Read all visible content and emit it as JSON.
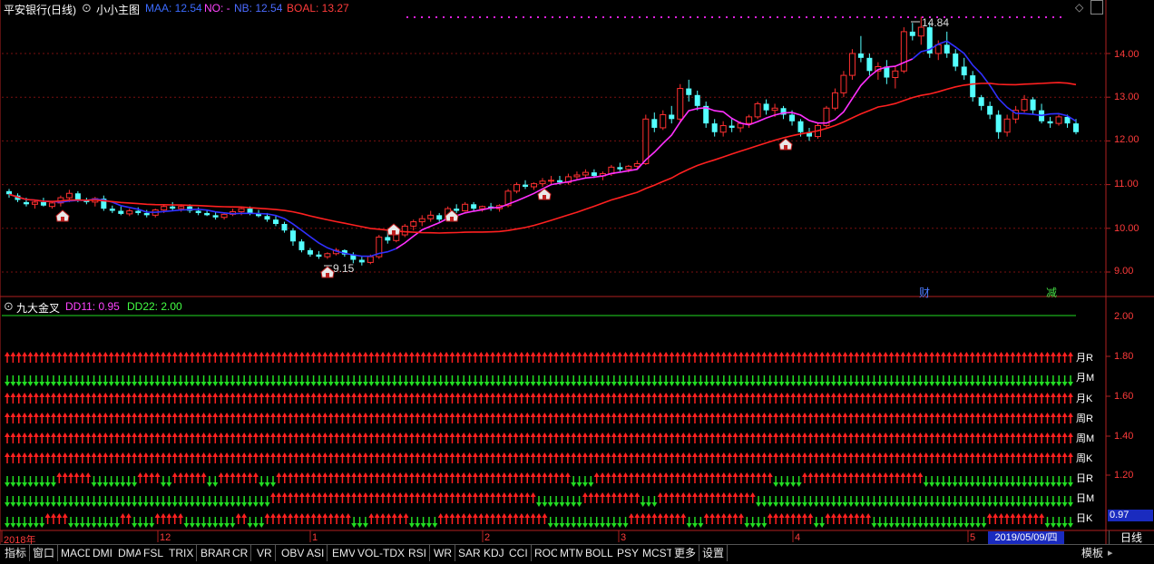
{
  "main": {
    "title": "平安银行(日线)",
    "indicator_name": "小小主图",
    "maa": "MAA: 12.54",
    "no": "NO: -",
    "nb": "NB: 12.54",
    "boal": "BOAL: 13.27",
    "high_label": "14.84",
    "low_label": "9.15",
    "event_cai": "财",
    "event_jian": "减",
    "price_ticks": [
      "14.00",
      "13.00",
      "12.00",
      "11.00",
      "10.00",
      "9.00"
    ]
  },
  "sub": {
    "indicator_name": "九大金叉",
    "dd11": "DD11: 0.95",
    "dd22": "DD22: 2.00",
    "value_ticks": [
      "2.00",
      "1.80",
      "1.60",
      "1.40",
      "1.20"
    ],
    "current_value": "0.97",
    "row_labels": [
      "月R",
      "月M",
      "月K",
      "周R",
      "周M",
      "周K",
      "日R",
      "日M",
      "日K"
    ]
  },
  "time_axis": {
    "labels": [
      "2018年",
      "12",
      "1",
      "2",
      "3",
      "4",
      "5"
    ],
    "cursor_date": "2019/05/09/四",
    "period": "日线"
  },
  "tabs": [
    "指标",
    "窗口",
    "MACD",
    "DMI",
    "DMA",
    "FSL",
    "TRIX",
    "BRAR",
    "CR",
    "VR",
    "OBV",
    "ASI",
    "EMV",
    "VOL-TDX",
    "RSI",
    "WR",
    "SAR",
    "KDJ",
    "CCI",
    "ROC",
    "MTM",
    "BOLL",
    "PSY",
    "MCST",
    "更多",
    "设置"
  ],
  "template_tab": "模板",
  "chart_data": {
    "type": "candlestick",
    "ylim": [
      8.8,
      14.9
    ],
    "ohlc": [
      [
        10.85,
        10.9,
        10.7,
        10.78
      ],
      [
        10.75,
        10.8,
        10.6,
        10.65
      ],
      [
        10.6,
        10.7,
        10.5,
        10.55
      ],
      [
        10.55,
        10.65,
        10.45,
        10.6
      ],
      [
        10.6,
        10.7,
        10.5,
        10.52
      ],
      [
        10.5,
        10.62,
        10.45,
        10.58
      ],
      [
        10.58,
        10.75,
        10.5,
        10.7
      ],
      [
        10.7,
        10.88,
        10.6,
        10.8
      ],
      [
        10.8,
        10.85,
        10.6,
        10.65
      ],
      [
        10.65,
        10.7,
        10.55,
        10.6
      ],
      [
        10.6,
        10.72,
        10.5,
        10.68
      ],
      [
        10.68,
        10.75,
        10.4,
        10.45
      ],
      [
        10.45,
        10.52,
        10.35,
        10.4
      ],
      [
        10.4,
        10.5,
        10.3,
        10.33
      ],
      [
        10.33,
        10.45,
        10.28,
        10.4
      ],
      [
        10.4,
        10.48,
        10.3,
        10.35
      ],
      [
        10.35,
        10.42,
        10.25,
        10.3
      ],
      [
        10.3,
        10.45,
        10.25,
        10.42
      ],
      [
        10.42,
        10.55,
        10.35,
        10.5
      ],
      [
        10.5,
        10.6,
        10.4,
        10.45
      ],
      [
        10.45,
        10.55,
        10.38,
        10.5
      ],
      [
        10.5,
        10.55,
        10.35,
        10.4
      ],
      [
        10.4,
        10.48,
        10.3,
        10.35
      ],
      [
        10.35,
        10.42,
        10.28,
        10.3
      ],
      [
        10.3,
        10.38,
        10.2,
        10.25
      ],
      [
        10.25,
        10.35,
        10.2,
        10.32
      ],
      [
        10.32,
        10.45,
        10.28,
        10.38
      ],
      [
        10.38,
        10.5,
        10.3,
        10.45
      ],
      [
        10.45,
        10.5,
        10.3,
        10.35
      ],
      [
        10.35,
        10.42,
        10.25,
        10.28
      ],
      [
        10.28,
        10.35,
        10.15,
        10.2
      ],
      [
        10.2,
        10.28,
        10.05,
        10.1
      ],
      [
        10.1,
        10.15,
        9.9,
        9.95
      ],
      [
        9.95,
        10.0,
        9.6,
        9.7
      ],
      [
        9.7,
        9.75,
        9.45,
        9.5
      ],
      [
        9.5,
        9.55,
        9.35,
        9.4
      ],
      [
        9.4,
        9.48,
        9.3,
        9.35
      ],
      [
        9.35,
        9.45,
        9.3,
        9.42
      ],
      [
        9.42,
        9.55,
        9.38,
        9.5
      ],
      [
        9.5,
        9.52,
        9.35,
        9.4
      ],
      [
        9.4,
        9.45,
        9.2,
        9.28
      ],
      [
        9.28,
        9.35,
        9.15,
        9.22
      ],
      [
        9.22,
        9.4,
        9.18,
        9.35
      ],
      [
        9.35,
        9.85,
        9.3,
        9.8
      ],
      [
        9.8,
        9.95,
        9.65,
        9.72
      ],
      [
        9.72,
        9.9,
        9.68,
        9.85
      ],
      [
        9.85,
        10.1,
        9.8,
        10.05
      ],
      [
        10.05,
        10.2,
        9.95,
        10.15
      ],
      [
        10.15,
        10.3,
        10.05,
        10.22
      ],
      [
        10.22,
        10.4,
        10.15,
        10.3
      ],
      [
        10.3,
        10.35,
        10.15,
        10.2
      ],
      [
        10.2,
        10.5,
        10.18,
        10.45
      ],
      [
        10.45,
        10.55,
        10.35,
        10.4
      ],
      [
        10.4,
        10.6,
        10.38,
        10.55
      ],
      [
        10.55,
        10.6,
        10.4,
        10.45
      ],
      [
        10.45,
        10.52,
        10.38,
        10.5
      ],
      [
        10.5,
        10.58,
        10.4,
        10.45
      ],
      [
        10.45,
        10.55,
        10.38,
        10.52
      ],
      [
        10.52,
        10.9,
        10.48,
        10.85
      ],
      [
        10.85,
        11.05,
        10.8,
        11.0
      ],
      [
        11.0,
        11.1,
        10.9,
        10.95
      ],
      [
        10.95,
        11.05,
        10.88,
        11.02
      ],
      [
        11.02,
        11.15,
        10.95,
        11.08
      ],
      [
        11.08,
        11.2,
        11.0,
        11.1
      ],
      [
        11.1,
        11.2,
        11.0,
        11.05
      ],
      [
        11.05,
        11.25,
        11.0,
        11.18
      ],
      [
        11.18,
        11.3,
        11.1,
        11.22
      ],
      [
        11.22,
        11.35,
        11.15,
        11.28
      ],
      [
        11.28,
        11.35,
        11.15,
        11.2
      ],
      [
        11.2,
        11.3,
        11.1,
        11.25
      ],
      [
        11.25,
        11.45,
        11.2,
        11.4
      ],
      [
        11.4,
        11.5,
        11.3,
        11.35
      ],
      [
        11.35,
        11.45,
        11.28,
        11.42
      ],
      [
        11.42,
        11.55,
        11.35,
        11.48
      ],
      [
        11.48,
        12.6,
        11.45,
        12.5
      ],
      [
        12.5,
        12.65,
        12.2,
        12.3
      ],
      [
        12.3,
        12.7,
        12.25,
        12.6
      ],
      [
        12.6,
        12.8,
        12.4,
        12.5
      ],
      [
        12.5,
        13.3,
        12.45,
        13.2
      ],
      [
        13.2,
        13.4,
        12.9,
        13.05
      ],
      [
        13.05,
        13.15,
        12.7,
        12.8
      ],
      [
        12.8,
        12.9,
        12.3,
        12.4
      ],
      [
        12.4,
        12.5,
        12.1,
        12.2
      ],
      [
        12.2,
        12.45,
        12.1,
        12.35
      ],
      [
        12.35,
        12.5,
        12.2,
        12.3
      ],
      [
        12.3,
        12.45,
        12.2,
        12.4
      ],
      [
        12.4,
        12.6,
        12.3,
        12.55
      ],
      [
        12.55,
        12.9,
        12.5,
        12.85
      ],
      [
        12.85,
        12.95,
        12.6,
        12.7
      ],
      [
        12.7,
        12.85,
        12.55,
        12.75
      ],
      [
        12.75,
        12.8,
        12.5,
        12.6
      ],
      [
        12.6,
        12.7,
        12.35,
        12.45
      ],
      [
        12.45,
        12.5,
        12.1,
        12.2
      ],
      [
        12.2,
        12.3,
        12.0,
        12.1
      ],
      [
        12.1,
        12.4,
        12.05,
        12.35
      ],
      [
        12.35,
        12.8,
        12.3,
        12.75
      ],
      [
        12.75,
        13.2,
        12.7,
        13.1
      ],
      [
        13.1,
        13.6,
        13.0,
        13.5
      ],
      [
        13.5,
        14.1,
        13.4,
        14.0
      ],
      [
        14.0,
        14.4,
        13.8,
        13.9
      ],
      [
        13.9,
        14.0,
        13.5,
        13.6
      ],
      [
        13.6,
        13.8,
        13.4,
        13.7
      ],
      [
        13.7,
        13.85,
        13.3,
        13.45
      ],
      [
        13.45,
        13.7,
        13.2,
        13.6
      ],
      [
        13.6,
        14.6,
        13.55,
        14.5
      ],
      [
        14.5,
        14.7,
        14.3,
        14.4
      ],
      [
        14.4,
        14.84,
        14.2,
        14.6
      ],
      [
        14.6,
        14.7,
        13.9,
        14.0
      ],
      [
        14.0,
        14.3,
        13.85,
        14.2
      ],
      [
        14.2,
        14.5,
        13.9,
        14.0
      ],
      [
        14.0,
        14.1,
        13.6,
        13.7
      ],
      [
        13.7,
        13.9,
        13.4,
        13.5
      ],
      [
        13.5,
        13.6,
        12.9,
        13.0
      ],
      [
        13.0,
        13.05,
        12.7,
        12.8
      ],
      [
        12.8,
        12.9,
        12.5,
        12.6
      ],
      [
        12.6,
        12.7,
        12.05,
        12.2
      ],
      [
        12.2,
        12.6,
        12.1,
        12.5
      ],
      [
        12.5,
        12.8,
        12.4,
        12.7
      ],
      [
        12.7,
        13.05,
        12.65,
        12.95
      ],
      [
        12.95,
        13.0,
        12.6,
        12.7
      ],
      [
        12.7,
        12.85,
        12.4,
        12.45
      ],
      [
        12.45,
        12.55,
        12.3,
        12.4
      ],
      [
        12.4,
        12.6,
        12.35,
        12.55
      ],
      [
        12.55,
        12.6,
        12.3,
        12.4
      ],
      [
        12.4,
        12.5,
        12.15,
        12.2
      ]
    ],
    "sub_rows": [
      {
        "label": "月R",
        "pattern": "up"
      },
      {
        "label": "月M",
        "pattern": "down"
      },
      {
        "label": "月K",
        "pattern": "up"
      },
      {
        "label": "周R",
        "pattern": "up"
      },
      {
        "label": "周M",
        "pattern": "up"
      },
      {
        "label": "周K",
        "pattern": "up"
      },
      {
        "label": "日R",
        "pattern": "mixed1"
      },
      {
        "label": "日M",
        "pattern": "mixed2"
      },
      {
        "label": "日K",
        "pattern": "mixed3"
      }
    ]
  },
  "colors": {
    "up": "#ff3030",
    "down": "#54ffff",
    "ma_blue": "#3030ff",
    "ma_magenta": "#ff30ff",
    "ma_red": "#ff2020",
    "arrow_up": "#ff2020",
    "arrow_down": "#22dd22"
  }
}
